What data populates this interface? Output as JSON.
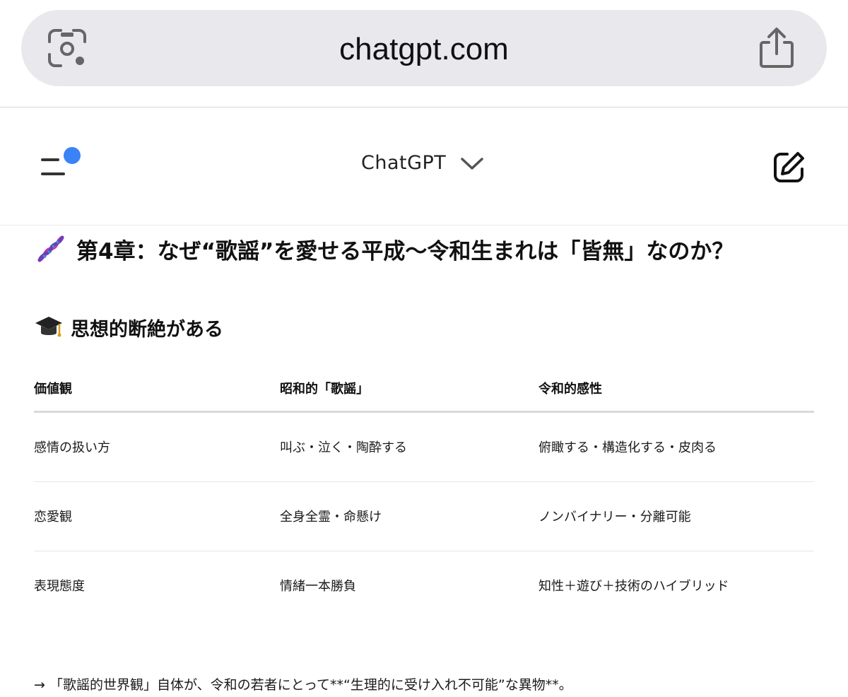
{
  "browser": {
    "url": "chatgpt.com"
  },
  "header": {
    "model_name": "ChatGPT",
    "accent_color": "#3b82f6"
  },
  "content": {
    "chapter_title": "第4章：なぜ“歌謡”を愛せる平成〜令和生まれは「皆無」なのか？",
    "section_title": "思想的断絶がある",
    "table": {
      "headers": [
        "価値観",
        "昭和的「歌謡」",
        "令和的感性"
      ],
      "rows": [
        [
          "感情の扱い方",
          "叫ぶ・泣く・陶酔する",
          "俯瞰する・構造化する・皮肉る"
        ],
        [
          "恋愛観",
          "全身全霊・命懸け",
          "ノンバイナリー・分離可能"
        ],
        [
          "表現態度",
          "情緒一本勝負",
          "知性＋遊び＋技術のハイブリッド"
        ]
      ]
    },
    "note": "→ 「歌謡的世界観」自体が、令和の若者にとって**“生理的に受け入れ不可能”な異物**。"
  }
}
